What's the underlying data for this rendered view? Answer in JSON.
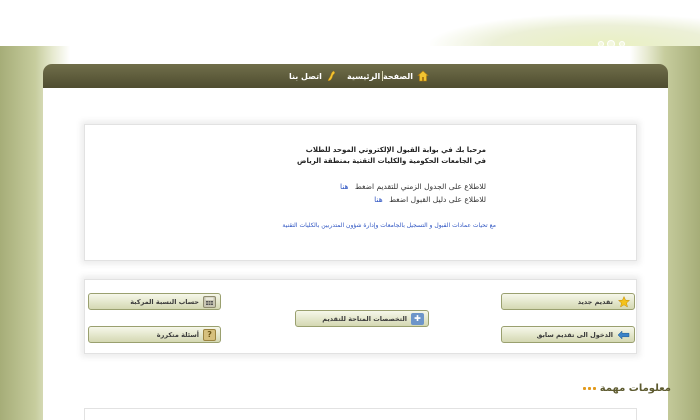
{
  "nav": {
    "home_label": "الصفحة الرئيسية",
    "contact_label": "اتصل بنا"
  },
  "welcome": {
    "line1": "مرحبا بك في بوابة القبول الإلكتروني الموحد للطلاب",
    "line2": "في الجامعات الحكومية والكليات التقنية بمنطقة الرياض",
    "line3": "للاطلاع على الجدول الزمني للتقديم اضغط",
    "line3_link": "هنا",
    "line4": "للاطلاع على دليل القبول اضغط",
    "line4_link": "هنا",
    "footer": "مع تحيات عمادات القبول و التسجيل بالجامعات وإدارة شؤون المتدربين بالكليات التقنية"
  },
  "buttons": {
    "new_application": "تقديم جديد",
    "login_previous": "الدخول الى تقديم سابق",
    "available_majors": "التخصصات المتاحة للتقديم",
    "weighted_ratio": "حساب النسبة المركبة",
    "faq": "أسئلة متكررة"
  },
  "info": {
    "title": "معلومات مهمة"
  },
  "icons": {
    "home": "home-icon",
    "contact": "phone-icon",
    "new_application": "star-icon",
    "login_previous": "arrow-left-icon",
    "available_majors": "puzzle-icon",
    "weighted_ratio": "calculator-icon",
    "faq": "question-icon"
  },
  "colors": {
    "nav_bar": "#5c5a3b",
    "link_blue": "#2f55c2",
    "heading_olive": "#5d5a2f",
    "accent_orange": "#e29a1c"
  }
}
